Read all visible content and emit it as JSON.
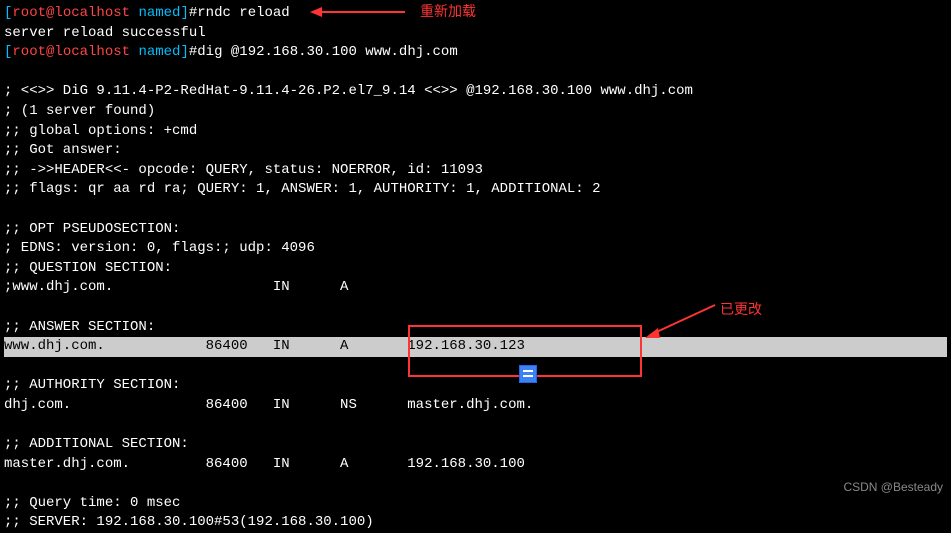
{
  "prompts": {
    "user": "root",
    "host": "localhost",
    "path": "named",
    "cmd1": "rndc reload",
    "cmd2": "dig @192.168.30.100 www.dhj.com"
  },
  "output": {
    "reload_result": "server reload successful",
    "dig_header": "; <<>> DiG 9.11.4-P2-RedHat-9.11.4-26.P2.el7_9.14 <<>> @192.168.30.100 www.dhj.com",
    "server_found": "; (1 server found)",
    "global_opts": ";; global options: +cmd",
    "got_answer": ";; Got answer:",
    "header_line": ";; ->>HEADER<<- opcode: QUERY, status: NOERROR, id: 11093",
    "flags_line": ";; flags: qr aa rd ra; QUERY: 1, ANSWER: 1, AUTHORITY: 1, ADDITIONAL: 2",
    "opt_section": ";; OPT PSEUDOSECTION:",
    "edns_line": "; EDNS: version: 0, flags:; udp: 4096",
    "question_section": ";; QUESTION SECTION:",
    "question_record": ";www.dhj.com.                   IN      A",
    "answer_section": ";; ANSWER SECTION:",
    "answer_record": "www.dhj.com.            86400   IN      A       192.168.30.123",
    "authority_section": ";; AUTHORITY SECTION:",
    "authority_record": "dhj.com.                86400   IN      NS      master.dhj.com.",
    "additional_section": ";; ADDITIONAL SECTION:",
    "additional_record": "master.dhj.com.         86400   IN      A       192.168.30.100",
    "query_time": ";; Query time: 0 msec",
    "server_line": ";; SERVER: 192.168.30.100#53(192.168.30.100)"
  },
  "annotations": {
    "reload_label": "重新加载",
    "changed_label": "已更改"
  },
  "watermark": "CSDN @Besteady"
}
